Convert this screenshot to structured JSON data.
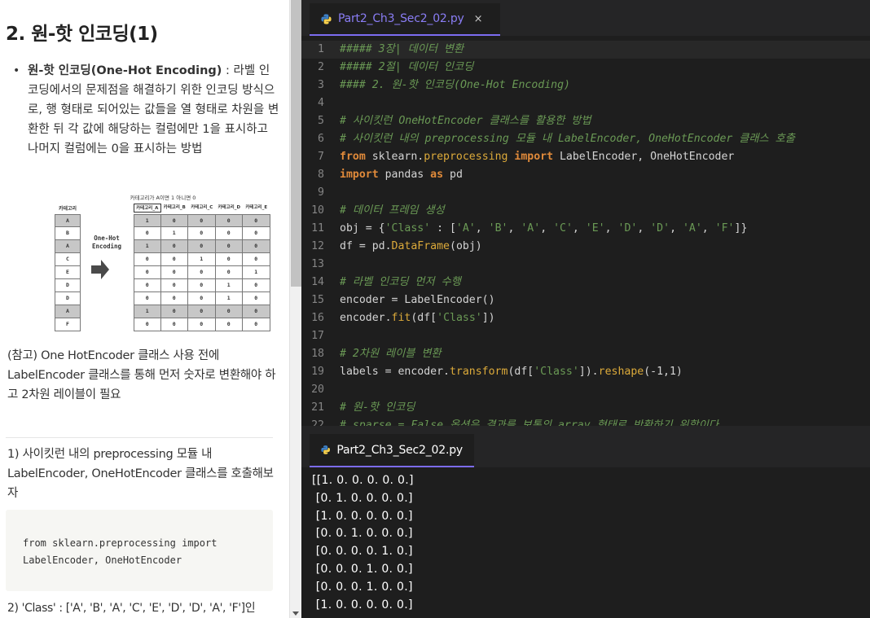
{
  "lesson": {
    "title": "2. 원-핫 인코딩(1)",
    "bullet": {
      "term": "원-핫 인코딩(One-Hot Encoding)",
      "text": " : 라벨 인코딩에서의 문제점을 해결하기 위한 인코딩 방식으로, 행 형태로 되어있는 값들을 열 형태로 차원을 변환한 뒤 각 값에 해당하는 컬럼에만 1을 표시하고 나머지 컬럼에는 0을 표시하는 방법"
    },
    "diagram": {
      "caption": "카테고리가 A이면 1 아니면 0",
      "left_header": "카테고리",
      "categories": [
        "A",
        "B",
        "A",
        "C",
        "E",
        "D",
        "D",
        "A",
        "F"
      ],
      "highlighted_rows": [
        0,
        2,
        7
      ],
      "encoding_label_1": "One-Hot",
      "encoding_label_2": "Encoding",
      "columns": [
        "카테고리_A",
        "카테고리_B",
        "카테고리_C",
        "카테고리_D",
        "카테고리_E"
      ],
      "matrix": [
        [
          "1",
          "0",
          "0",
          "0",
          "0"
        ],
        [
          "0",
          "1",
          "0",
          "0",
          "0"
        ],
        [
          "1",
          "0",
          "0",
          "0",
          "0"
        ],
        [
          "0",
          "0",
          "1",
          "0",
          "0"
        ],
        [
          "0",
          "0",
          "0",
          "0",
          "1"
        ],
        [
          "0",
          "0",
          "0",
          "1",
          "0"
        ],
        [
          "0",
          "0",
          "0",
          "1",
          "0"
        ],
        [
          "1",
          "0",
          "0",
          "0",
          "0"
        ],
        [
          "0",
          "0",
          "0",
          "0",
          "0"
        ]
      ]
    },
    "note": "(참고) One HotEncoder 클래스 사용 전에 LabelEncoder 클래스를 통해 먼저 숫자로 변환해야 하고 2차원 레이블이 필요",
    "step1": "1) 사이킷런 내의 preprocessing 모듈 내 LabelEncoder, OneHotEncoder 클래스를 호출해보자",
    "code_snippet": [
      "from sklearn.preprocessing import",
      "LabelEncoder, OneHotEncoder"
    ],
    "step2": "2) 'Class' : ['A', 'B', 'A', 'C', 'E', 'D', 'D', 'A', 'F']인"
  },
  "editor": {
    "tab_top": "Part2_Ch3_Sec2_02.py",
    "tab_close": "×",
    "tab_bottom": "Part2_Ch3_Sec2_02.py",
    "colors": {
      "accent": "#7c6cf0",
      "background": "#1e1e1e",
      "comment": "#6a9955",
      "keyword": "#e08a3a"
    },
    "lines": [
      [
        {
          "t": "##### 3장| 데이터 변환",
          "c": "com"
        }
      ],
      [
        {
          "t": "##### 2절| 데이터 인코딩",
          "c": "com"
        }
      ],
      [
        {
          "t": "#### 2. 원-핫 인코딩(One-Hot Encoding)",
          "c": "com"
        }
      ],
      [],
      [
        {
          "t": "# 사이킷런 OneHotEncoder 클래스를 활용한 방법",
          "c": "com"
        }
      ],
      [
        {
          "t": "# 사이킷런 내의 preprocessing 모듈 내 LabelEncoder, OneHotEncoder 클래스 호출",
          "c": "com"
        }
      ],
      [
        {
          "t": "from",
          "c": "kw"
        },
        {
          "t": " sklearn."
        },
        {
          "t": "preprocessing",
          "c": "fn"
        },
        {
          "t": " "
        },
        {
          "t": "import",
          "c": "kw"
        },
        {
          "t": " LabelEncoder, OneHotEncoder"
        }
      ],
      [
        {
          "t": "import",
          "c": "kw"
        },
        {
          "t": " pandas "
        },
        {
          "t": "as",
          "c": "kw"
        },
        {
          "t": " pd"
        }
      ],
      [],
      [
        {
          "t": "# 데이터 프레임 생성",
          "c": "com"
        }
      ],
      [
        {
          "t": "obj = {"
        },
        {
          "t": "'Class'",
          "c": "str"
        },
        {
          "t": " : ["
        },
        {
          "t": "'A'",
          "c": "str"
        },
        {
          "t": ", "
        },
        {
          "t": "'B'",
          "c": "str"
        },
        {
          "t": ", "
        },
        {
          "t": "'A'",
          "c": "str"
        },
        {
          "t": ", "
        },
        {
          "t": "'C'",
          "c": "str"
        },
        {
          "t": ", "
        },
        {
          "t": "'E'",
          "c": "str"
        },
        {
          "t": ", "
        },
        {
          "t": "'D'",
          "c": "str"
        },
        {
          "t": ", "
        },
        {
          "t": "'D'",
          "c": "str"
        },
        {
          "t": ", "
        },
        {
          "t": "'A'",
          "c": "str"
        },
        {
          "t": ", "
        },
        {
          "t": "'F'",
          "c": "str"
        },
        {
          "t": "]}"
        }
      ],
      [
        {
          "t": "df = pd."
        },
        {
          "t": "DataFrame",
          "c": "fn"
        },
        {
          "t": "(obj)"
        }
      ],
      [],
      [
        {
          "t": "# 라벨 인코딩 먼저 수행",
          "c": "com"
        }
      ],
      [
        {
          "t": "encoder = LabelEncoder()"
        }
      ],
      [
        {
          "t": "encoder."
        },
        {
          "t": "fit",
          "c": "fn"
        },
        {
          "t": "(df["
        },
        {
          "t": "'Class'",
          "c": "str"
        },
        {
          "t": "])"
        }
      ],
      [],
      [
        {
          "t": "# 2차원 레이블 변환",
          "c": "com"
        }
      ],
      [
        {
          "t": "labels = encoder."
        },
        {
          "t": "transform",
          "c": "fn"
        },
        {
          "t": "(df["
        },
        {
          "t": "'Class'",
          "c": "str"
        },
        {
          "t": "])."
        },
        {
          "t": "reshape",
          "c": "fn"
        },
        {
          "t": "(-1,1)"
        }
      ],
      [],
      [
        {
          "t": "# 원-핫 인코딩",
          "c": "com"
        }
      ],
      [
        {
          "t": "# sparse = False 옵션은 결과를 보통의 array 형태로 반환하기 위함이다",
          "c": "com"
        }
      ]
    ],
    "output_lines": [
      "[[1. 0. 0. 0. 0. 0.]",
      " [0. 1. 0. 0. 0. 0.]",
      " [1. 0. 0. 0. 0. 0.]",
      " [0. 0. 1. 0. 0. 0.]",
      " [0. 0. 0. 0. 1. 0.]",
      " [0. 0. 0. 1. 0. 0.]",
      " [0. 0. 0. 1. 0. 0.]",
      " [1. 0. 0. 0. 0. 0.]"
    ]
  }
}
